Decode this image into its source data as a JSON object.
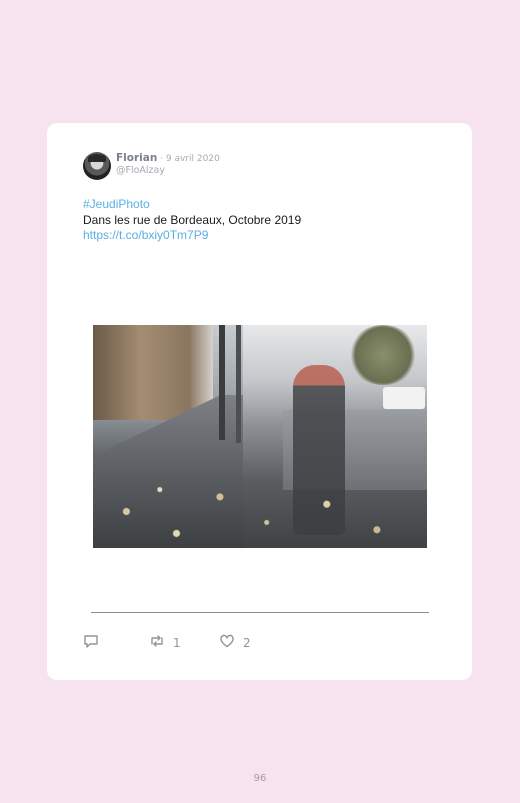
{
  "tweet": {
    "author_name": "Florian",
    "separator": " · ",
    "date": "9 avril 2020",
    "handle": "@FloAlzay",
    "hashtag": "#JeudiPhoto",
    "text": "Dans les rue de Bordeaux, Octobre 2019",
    "link": "https://t.co/bxiy0Tm7P9"
  },
  "actions": {
    "reply_count": "",
    "retweet_count": "1",
    "like_count": "2"
  },
  "icons": {
    "avatar": "user-avatar",
    "reply": "reply-icon",
    "retweet": "retweet-icon",
    "like": "heart-icon"
  },
  "colors": {
    "background": "#f6e3ef",
    "link": "#5aaee3",
    "card": "#ffffff"
  },
  "page": {
    "number": "96"
  }
}
